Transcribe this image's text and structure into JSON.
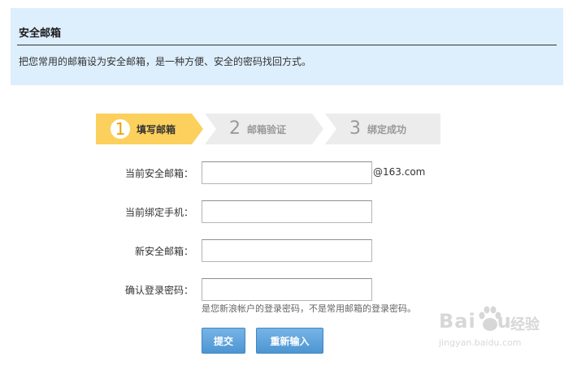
{
  "header": {
    "title": "安全邮箱",
    "description": "把您常用的邮箱设为安全邮箱，是一种方便、安全的密码找回方式。"
  },
  "steps": [
    {
      "number": "1",
      "label": "填写邮箱",
      "active": true
    },
    {
      "number": "2",
      "label": "邮箱验证",
      "active": false
    },
    {
      "number": "3",
      "label": "绑定成功",
      "active": false
    }
  ],
  "form": {
    "current_email": {
      "label": "当前安全邮箱：",
      "value": "",
      "suffix": "@163.com"
    },
    "current_phone": {
      "label": "当前绑定手机：",
      "value": ""
    },
    "new_email": {
      "label": "新安全邮箱：",
      "value": ""
    },
    "password": {
      "label": "确认登录密码：",
      "value": "",
      "hint": "是您新浪帐户的登录密码，不是常用邮箱的登录密码。"
    }
  },
  "buttons": {
    "submit": "提交",
    "reset": "重新输入"
  },
  "watermark": {
    "brand": "Bai",
    "brand_end": "u",
    "cn": "经验",
    "url": "jingyan.baidu.com"
  },
  "colors": {
    "panel_bg": "#ddeefc",
    "step_active": "#fcd05c",
    "step_inactive": "#ececec",
    "button": "#5aa2dc"
  }
}
